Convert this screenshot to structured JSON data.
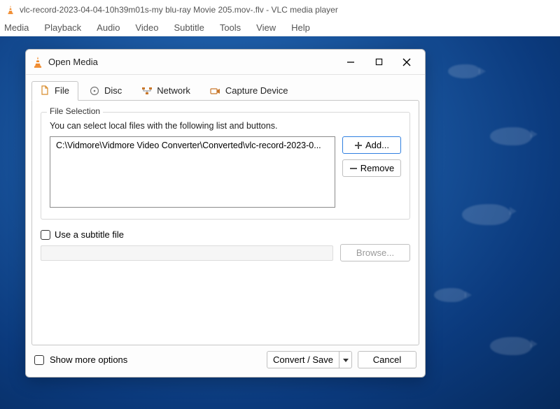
{
  "app": {
    "title": "vlc-record-2023-04-04-10h39m01s-my blu-ray Movie 205.mov-.flv - VLC media player"
  },
  "menubar": {
    "items": [
      "Media",
      "Playback",
      "Audio",
      "Video",
      "Subtitle",
      "Tools",
      "View",
      "Help"
    ]
  },
  "dialog": {
    "title": "Open Media",
    "tabs": {
      "file": {
        "label": "File",
        "icon": "file-icon"
      },
      "disc": {
        "label": "Disc",
        "icon": "disc-icon"
      },
      "network": {
        "label": "Network",
        "icon": "network-icon"
      },
      "capture": {
        "label": "Capture Device",
        "icon": "capture-icon"
      },
      "active": "file"
    },
    "file_selection": {
      "legend": "File Selection",
      "hint": "You can select local files with the following list and buttons.",
      "entries": [
        "C:\\Vidmore\\Vidmore Video Converter\\Converted\\vlc-record-2023-0..."
      ],
      "add_label": "Add...",
      "remove_label": "Remove"
    },
    "subtitle": {
      "checkbox_label": "Use a subtitle file",
      "checked": false,
      "path": "",
      "browse_label": "Browse..."
    },
    "show_more": {
      "label": "Show more options",
      "checked": false
    },
    "footer": {
      "primary_label": "Convert / Save",
      "cancel_label": "Cancel"
    }
  },
  "colors": {
    "accent": "#2f7fe0",
    "cone_orange": "#f08a2c"
  }
}
